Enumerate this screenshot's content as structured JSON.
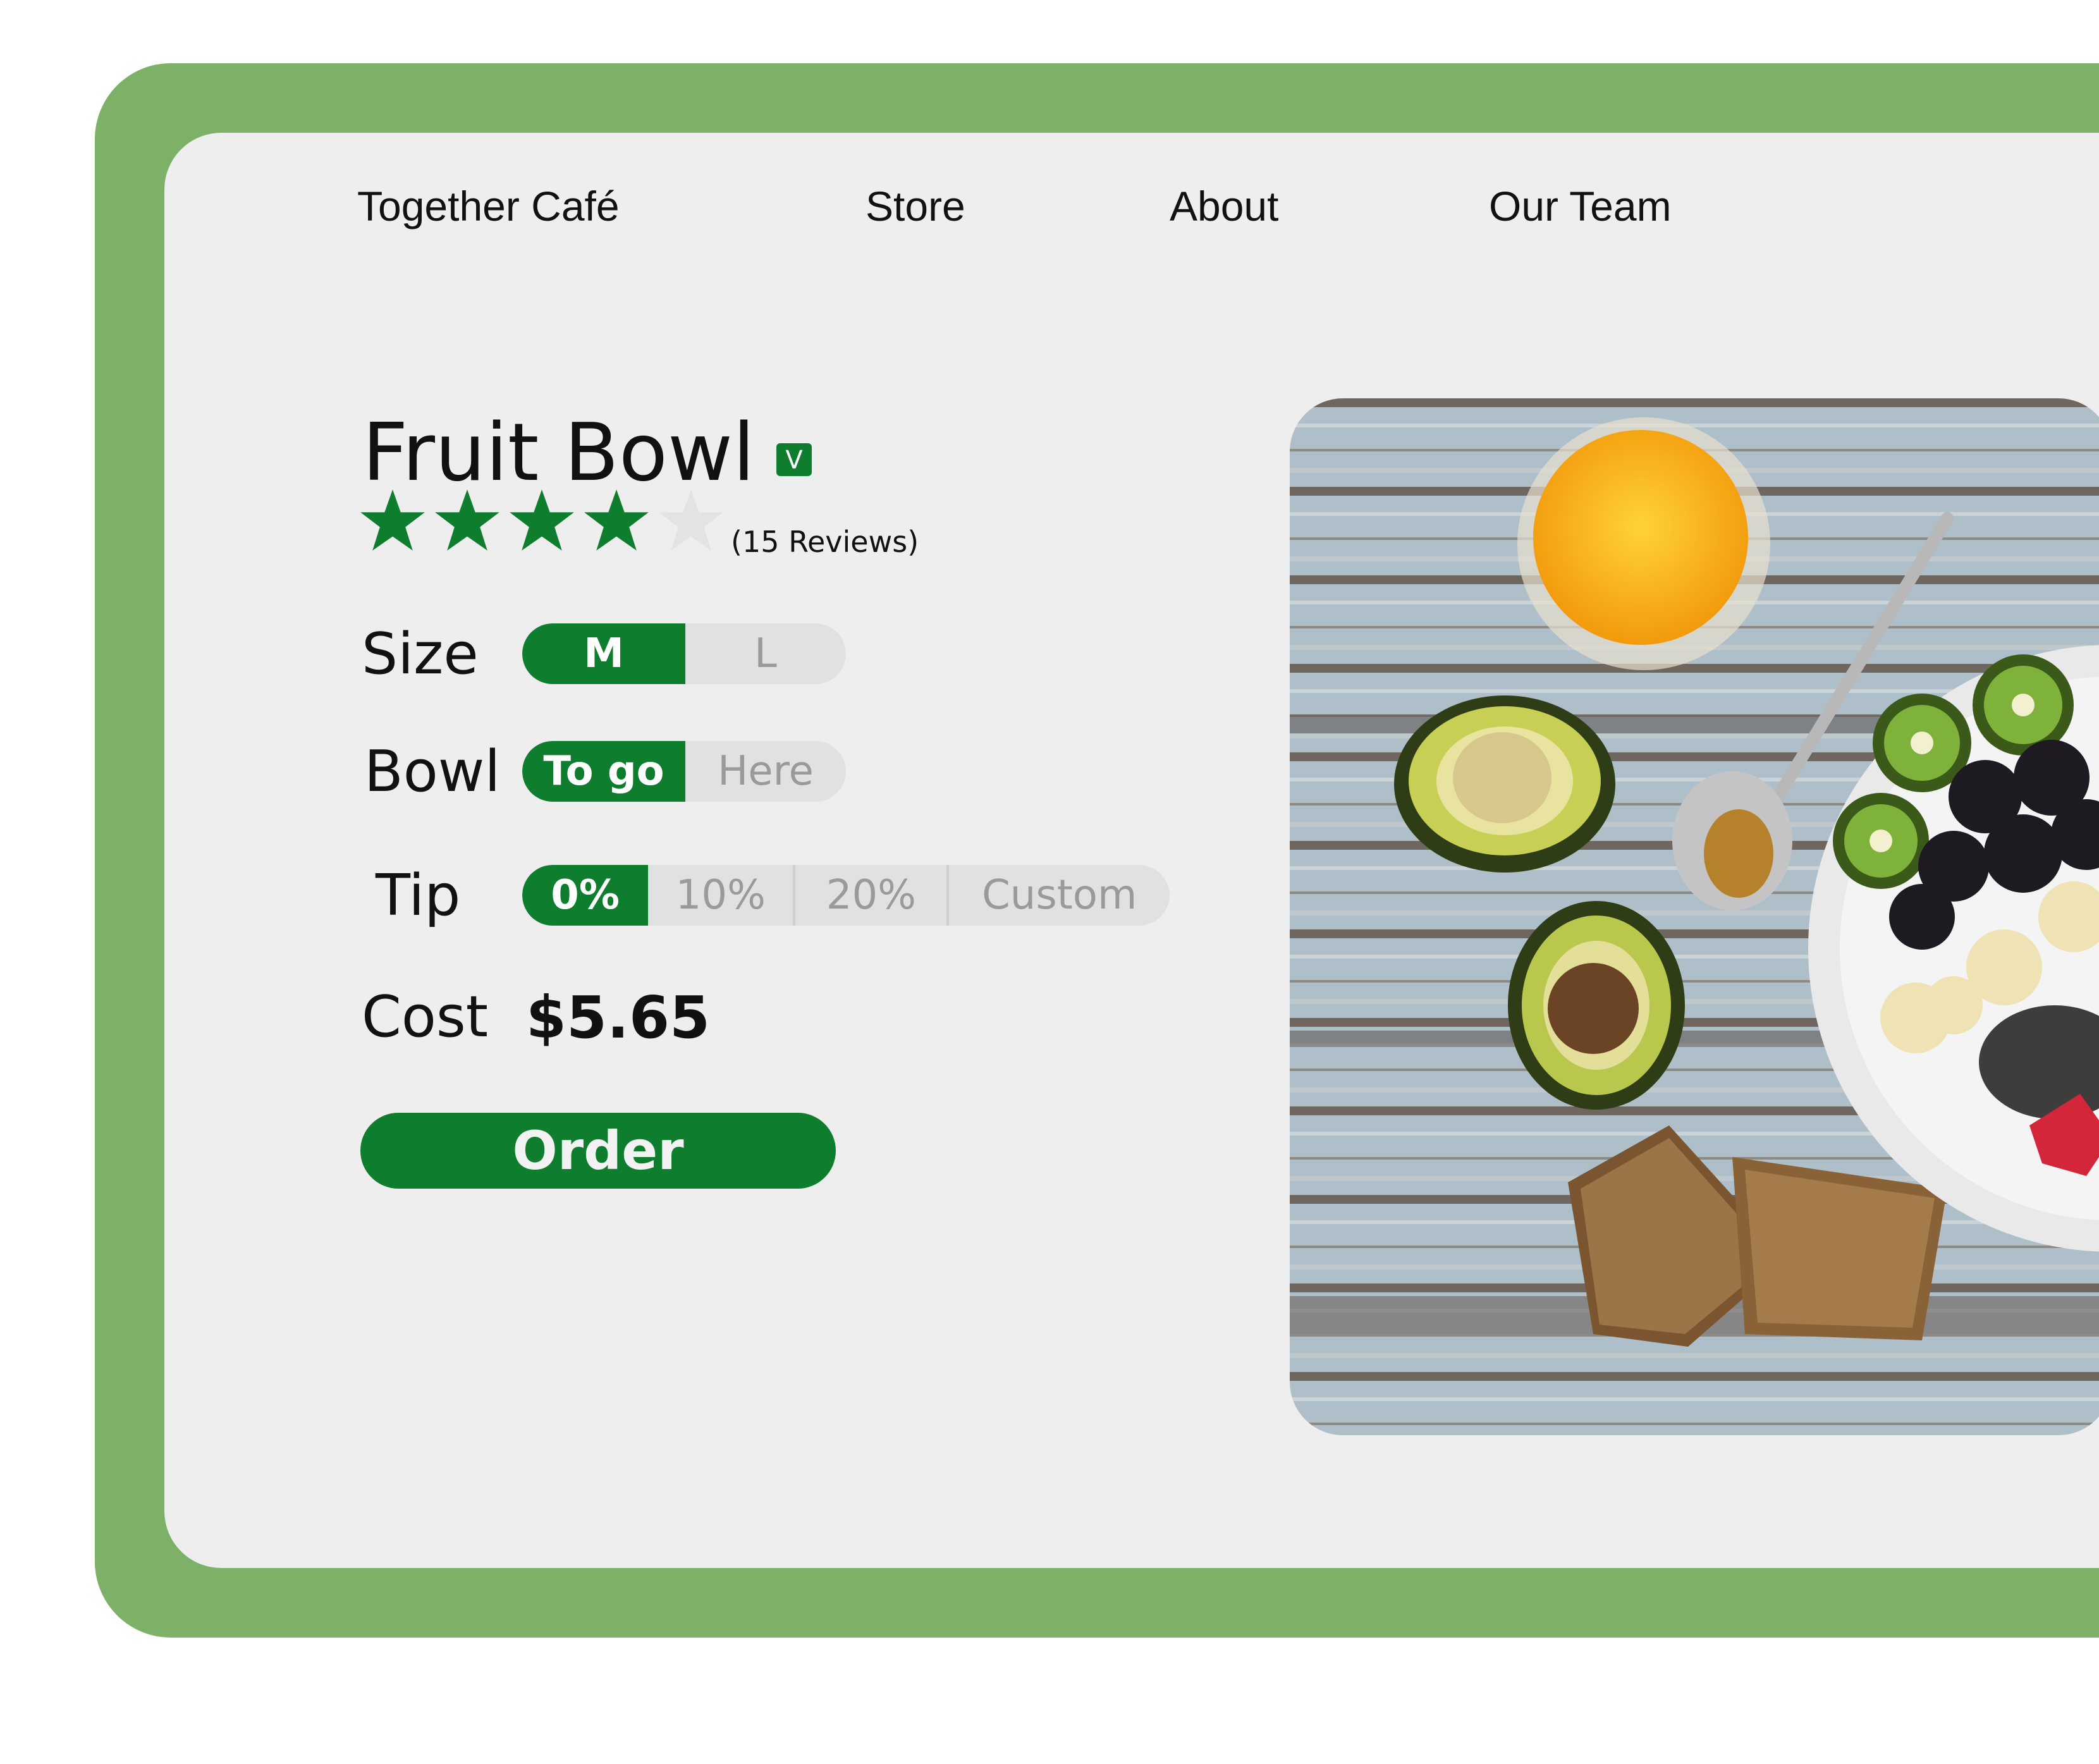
{
  "colors": {
    "accent": "#0f7d2e",
    "frame": "#7db168",
    "panel": "#efeeee",
    "segment_bg": "#e2e1e1"
  },
  "nav": {
    "brand": "Together Café",
    "items": [
      "Store",
      "About",
      "Our Team"
    ]
  },
  "product": {
    "title": "Fruit Bowl",
    "badge": "V",
    "rating": 4,
    "rating_max": 5,
    "reviews": "(15 Reviews)"
  },
  "options": {
    "size": {
      "label": "Size",
      "choices": [
        "M",
        "L"
      ],
      "selected": "M"
    },
    "bowl": {
      "label": "Bowl",
      "choices": [
        "To go",
        "Here"
      ],
      "selected": "To go"
    },
    "tip": {
      "label": "Tip",
      "choices": [
        "0%",
        "10%",
        "20%",
        "Custom"
      ],
      "selected": "0%"
    }
  },
  "cost": {
    "label": "Cost",
    "value": "$5.65"
  },
  "order_button": "Order",
  "image": {
    "icon": "food-photo"
  }
}
